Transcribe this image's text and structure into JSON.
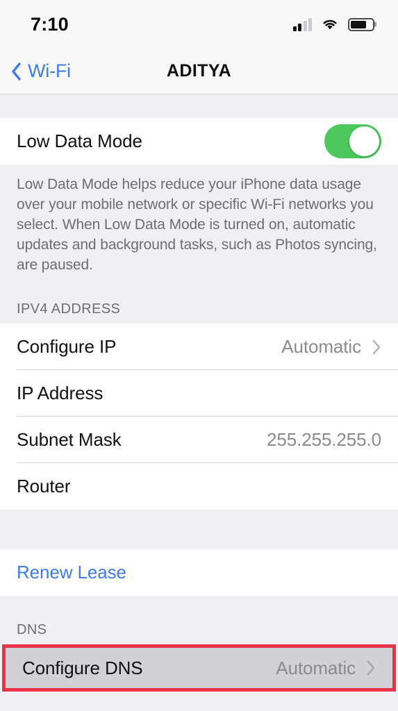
{
  "status_bar": {
    "time": "7:10",
    "cellular_icon": "cellular-signal-icon",
    "cellular_bars_filled": 2,
    "cellular_bars_total": 4,
    "wifi_icon": "wifi-icon",
    "battery_icon": "battery-icon",
    "battery_percent": 72
  },
  "nav_bar": {
    "back_icon": "chevron-left-icon",
    "back_label": "Wi-Fi",
    "title": "ADITYA"
  },
  "sections": {
    "low_data": {
      "row_label": "Low Data Mode",
      "toggle_state": "on",
      "toggle_on_color": "#4CC85C",
      "footer": "Low Data Mode helps reduce your iPhone data usage over your mobile network or specific Wi-Fi networks you select. When Low Data Mode is turned on, automatic updates and background tasks, such as Photos syncing, are paused."
    },
    "ipv4": {
      "header": "IPV4 ADDRESS",
      "rows": [
        {
          "label": "Configure IP",
          "value": "Automatic",
          "chevron": "chevron-right-icon"
        },
        {
          "label": "IP Address",
          "value": "",
          "chevron": ""
        },
        {
          "label": "Subnet Mask",
          "value": "255.255.255.0",
          "chevron": ""
        },
        {
          "label": "Router",
          "value": "",
          "chevron": ""
        }
      ]
    },
    "renew": {
      "label": "Renew Lease",
      "link_color": "#3E7BE8"
    },
    "dns": {
      "header": "DNS",
      "row": {
        "label": "Configure DNS",
        "value": "Automatic",
        "chevron": "chevron-right-icon"
      },
      "highlight_color": "#E8334A",
      "highlight_icon": "red-annotation-rectangle"
    }
  }
}
